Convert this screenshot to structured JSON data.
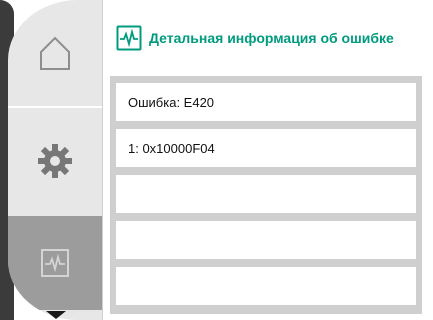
{
  "nav": {
    "items": [
      {
        "icon": "home-icon"
      },
      {
        "icon": "gear-icon"
      },
      {
        "icon": "diagnostics-icon"
      }
    ],
    "selected_index": 2
  },
  "header": {
    "icon": "diagnostics-icon",
    "title": "Детальная информация об ошибке",
    "accent_color": "#009b7e"
  },
  "error_details": {
    "rows": [
      {
        "text": "Ошибка: E420"
      },
      {
        "text": "1: 0x10000F04"
      },
      {
        "text": ""
      },
      {
        "text": ""
      },
      {
        "text": ""
      }
    ]
  }
}
